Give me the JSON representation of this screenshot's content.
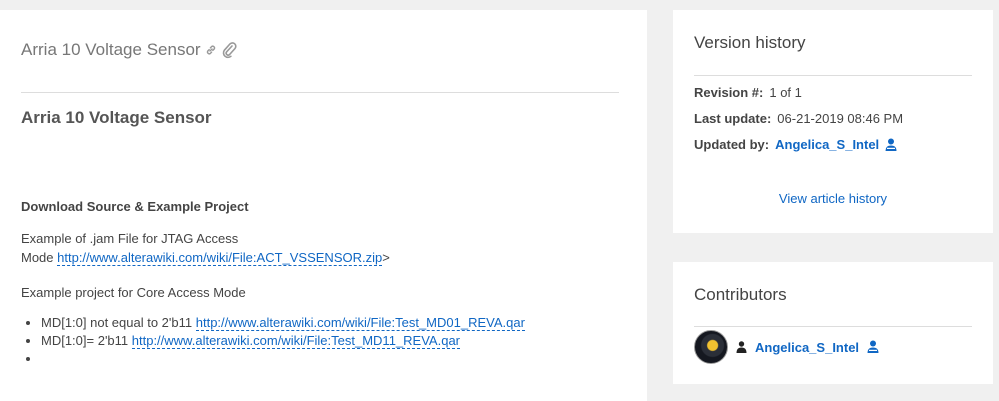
{
  "article": {
    "page_title": "Arria 10 Voltage Sensor",
    "heading": "Arria 10 Voltage Sensor",
    "section_heading": "Download Source & Example Project",
    "jam_text_1": "Example of .jam File for JTAG Access",
    "jam_text_2": "Mode ",
    "jam_link": "http://www.alterawiki.com/wiki/File:ACT_VSSENSOR.zip",
    "jam_suffix": ">",
    "core_text": "Example project for Core Access Mode",
    "bullets": [
      {
        "prefix": "MD[1:0] not equal to 2'b11 ",
        "link": "http://www.alterawiki.com/wiki/File:Test_MD01_REVA.qar"
      },
      {
        "prefix": "MD[1:0]= 2'b11 ",
        "link": "http://www.alterawiki.com/wiki/File:Test_MD11_REVA.qar"
      },
      {
        "prefix": "",
        "link": ""
      }
    ]
  },
  "version_history": {
    "title": "Version history",
    "revision_label": "Revision #:",
    "revision_value": "1 of 1",
    "last_update_label": "Last update:",
    "last_update_value": "06-21-2019 08:46 PM",
    "updated_by_label": "Updated by:",
    "updated_by_value": "Angelica_S_Intel",
    "history_link": "View article history"
  },
  "contributors": {
    "title": "Contributors",
    "items": [
      {
        "name": "Angelica_S_Intel"
      }
    ]
  },
  "icons": {
    "head": [
      "link-icon",
      "paperclip-icon"
    ],
    "user_badge": "employee-badge-icon",
    "person": "person-icon"
  },
  "colors": {
    "link": "#1067c4",
    "page_bg": "#f0f0f0"
  }
}
